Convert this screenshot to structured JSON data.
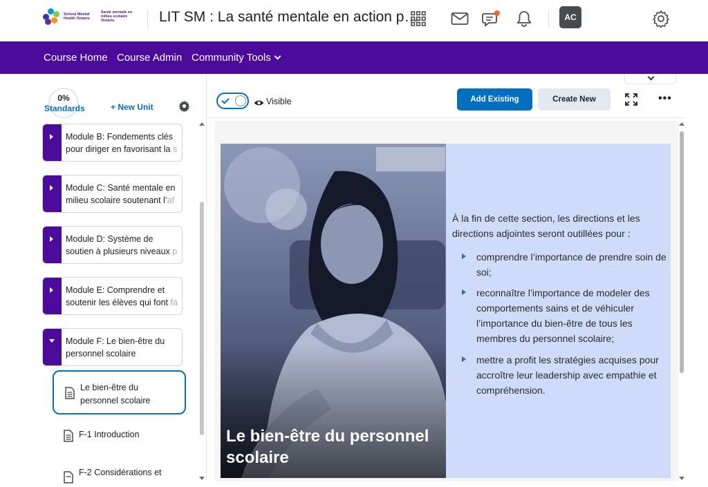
{
  "header": {
    "logo": {
      "en_text": "School Mental Health Ontario",
      "fr_text": "Santé mentale en milieu scolaire Ontario",
      "colors": [
        "#2f3e9e",
        "#00a0c6",
        "#8dc63f",
        "#f7941d",
        "#6a2c91"
      ]
    },
    "course_title": "LIT SM : La santé mentale en action p…",
    "icons": [
      "grid-icon",
      "mail-icon",
      "chat-alert-icon",
      "bell-icon",
      "gear-icon"
    ],
    "avatar_initials": "AC",
    "accent_notification": "#f26522"
  },
  "nav": {
    "background": "#4b0a9a",
    "items": [
      {
        "label": "Course Home"
      },
      {
        "label": "Course Admin"
      },
      {
        "label": "Community Tools"
      }
    ]
  },
  "left_panel": {
    "standards_pct": "0%",
    "standards_label": "Standards",
    "new_unit_label": "+ New Unit",
    "modules": [
      {
        "line1": "Module B: Fondements clés",
        "line2": "pour diriger en favorisant la",
        "line2_fade": " s",
        "expanded": false
      },
      {
        "line1": "Module C: Santé mentale en",
        "line2": "milieu scolaire soutenant l’",
        "line2_fade": "af",
        "expanded": false
      },
      {
        "line1": "Module D: Système de",
        "line2": "soutien à plusieurs niveaux ",
        "line2_fade": "p",
        "expanded": false
      },
      {
        "line1": "Module E: Comprendre et",
        "line2": "soutenir les élèves qui font ",
        "line2_fade": "fa",
        "expanded": false
      },
      {
        "line1": "Module F: Le bien-être du",
        "line2": "personnel scolaire",
        "line2_fade": "",
        "expanded": true
      }
    ],
    "topics": [
      {
        "line1": "Le bien-être du",
        "line2": "personnel scolaire",
        "active": true
      },
      {
        "line1": "F-1 Introduction",
        "line2": "",
        "active": false
      },
      {
        "line1": "F-2 Considérations et",
        "line2": "",
        "active": false
      }
    ]
  },
  "toolbar": {
    "visible_label": "Visible",
    "visible_on": true,
    "add_existing_label": "Add Existing",
    "create_new_label": "Create New",
    "more_label": "•••"
  },
  "content": {
    "image_caption": "Le bien-être du personnel scolaire",
    "intro": "À la fin de cette section, les directions et les directions adjointes seront outillées pour :",
    "bullets": [
      "comprendre l’importance de prendre soin de soi;",
      "reconnaître l’importance de modeler des comportements sains et de véhiculer l’importance du bien-être de tous les membres du personnel scolaire;",
      "mettre a profit les stratégies acquises pour accroître leur leadership avec empathie et compréhension."
    ],
    "panel_color": "#cfdcf9",
    "bullet_color": "#3d63b0"
  }
}
